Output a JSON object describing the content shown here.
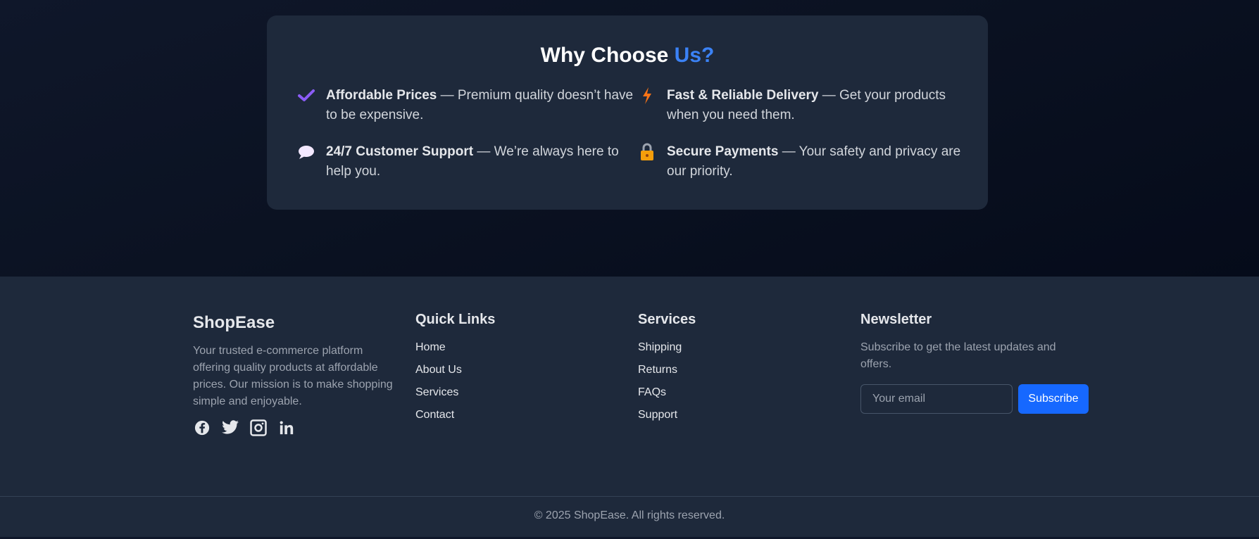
{
  "why": {
    "title_main": "Why Choose",
    "title_accent": "Us?",
    "features": [
      {
        "title": "Affordable Prices",
        "text": " — Premium quality doesn’t have to be expensive.",
        "icon": "checkmark-icon"
      },
      {
        "title": "Fast & Reliable Delivery",
        "text": " — Get your products when you need them.",
        "icon": "lightning-icon"
      },
      {
        "title": "24/7 Customer Support",
        "text": " — We’re always here to help you.",
        "icon": "speech-bubble-icon"
      },
      {
        "title": "Secure Payments",
        "text": " — Your safety and privacy are our priority.",
        "icon": "lock-icon"
      }
    ]
  },
  "footer": {
    "brand": "ShopEase",
    "description": "Your trusted e-commerce platform offering quality products at affordable prices. Our mission is to make shopping simple and enjoyable.",
    "quick_links": {
      "title": "Quick Links",
      "items": [
        "Home",
        "About Us",
        "Services",
        "Contact"
      ]
    },
    "services": {
      "title": "Services",
      "items": [
        "Shipping",
        "Returns",
        "FAQs",
        "Support"
      ]
    },
    "newsletter": {
      "title": "Newsletter",
      "text": "Subscribe to get the latest updates and offers.",
      "placeholder": "Your email",
      "button": "Subscribe"
    },
    "socials": [
      "facebook-icon",
      "twitter-icon",
      "instagram-icon",
      "linkedin-icon"
    ],
    "copyright": "© 2025 ShopEase. All rights reserved."
  },
  "colors": {
    "accent": "#3b82f6",
    "button": "#1668ff",
    "card": "#1e293b",
    "hero_bg": "#0f172a"
  }
}
